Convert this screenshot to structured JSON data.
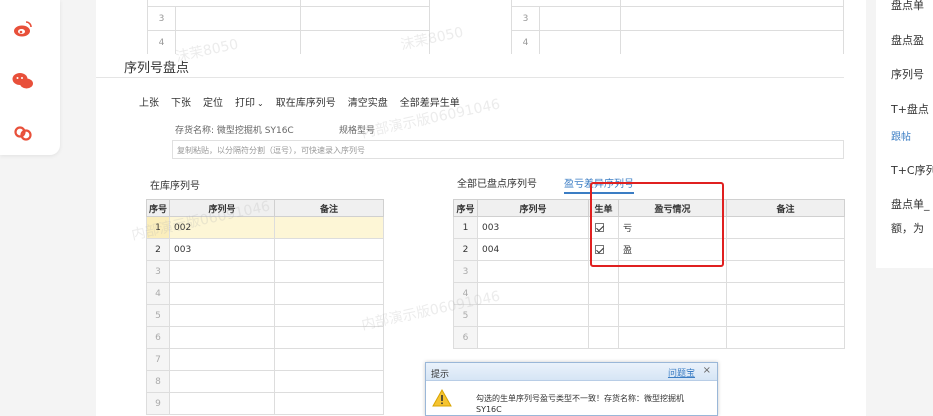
{
  "share": {
    "icons": [
      "weibo-icon",
      "wechat-icon",
      "link-icon"
    ],
    "colors": {
      "share": "#e8503a"
    }
  },
  "top_grid": {
    "rows": [
      "3",
      "4"
    ]
  },
  "page": {
    "title": "序列号盘点"
  },
  "toolbar": {
    "prev": "上张",
    "next": "下张",
    "locate": "定位",
    "print": "打印",
    "fetch": "取在库序列号",
    "clear": "清空实盘",
    "diff": "全部差异生单"
  },
  "meta": {
    "stock_label": "存货名称: 微型挖掘机 SY16C",
    "spec_label": "规格型号",
    "paste_placeholder": "复制粘贴，以分隔符分割（逗号），可快速录入序列号"
  },
  "left_table": {
    "label": "在库序列号",
    "headers": [
      "序号",
      "序列号",
      "备注"
    ],
    "rows": [
      {
        "n": "1",
        "sn": "002",
        "note": ""
      },
      {
        "n": "2",
        "sn": "003",
        "note": ""
      },
      {
        "n": "3",
        "sn": "",
        "note": ""
      },
      {
        "n": "4",
        "sn": "",
        "note": ""
      },
      {
        "n": "5",
        "sn": "",
        "note": ""
      },
      {
        "n": "6",
        "sn": "",
        "note": ""
      },
      {
        "n": "7",
        "sn": "",
        "note": ""
      },
      {
        "n": "8",
        "sn": "",
        "note": ""
      },
      {
        "n": "9",
        "sn": "",
        "note": ""
      }
    ]
  },
  "right_tabs": {
    "all": "全部已盘点序列号",
    "diff": "盈亏差异序列号"
  },
  "right_table": {
    "headers": [
      "序号",
      "序列号",
      "生单",
      "盈亏情况",
      "备注"
    ],
    "rows": [
      {
        "n": "1",
        "sn": "003",
        "checked": true,
        "status": "亏",
        "note": ""
      },
      {
        "n": "2",
        "sn": "004",
        "checked": true,
        "status": "盈",
        "note": ""
      },
      {
        "n": "3",
        "sn": "",
        "checked": false,
        "status": "",
        "note": ""
      },
      {
        "n": "4",
        "sn": "",
        "checked": false,
        "status": "",
        "note": ""
      },
      {
        "n": "5",
        "sn": "",
        "checked": false,
        "status": "",
        "note": ""
      },
      {
        "n": "6",
        "sn": "",
        "checked": false,
        "status": "",
        "note": ""
      }
    ]
  },
  "dialog": {
    "title": "提示",
    "link": "问题宝",
    "close": "×",
    "message": "勾选的生单序列号盈亏类型不一致！存货名称：微型挖掘机 SY16C"
  },
  "right_panel": {
    "lines": [
      "盘点单",
      "盘点盈",
      "序列号",
      "T+盘点",
      "跟帖",
      "T+C序列",
      "盘点单_",
      "额，为"
    ]
  },
  "watermarks": [
    "沫茉8050",
    "内部演示版0609104 6",
    "沫茉8050",
    "内部演示版06091046",
    "沫茉8050",
    "内部演示版06091046"
  ]
}
